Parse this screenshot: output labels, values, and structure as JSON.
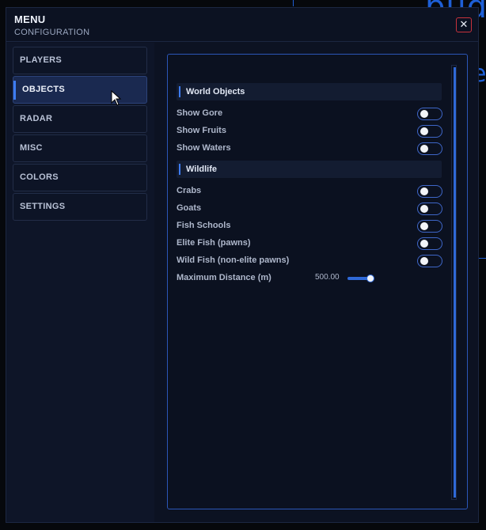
{
  "window": {
    "title": "MENU",
    "subtitle": "CONFIGURATION",
    "close_label": "✕"
  },
  "background_text": {
    "large": "bud",
    "small": "e"
  },
  "sidebar": {
    "items": [
      {
        "label": "PLAYERS",
        "active": false
      },
      {
        "label": "OBJECTS",
        "active": true
      },
      {
        "label": "RADAR",
        "active": false
      },
      {
        "label": "MISC",
        "active": false
      },
      {
        "label": "COLORS",
        "active": false
      },
      {
        "label": "SETTINGS",
        "active": false
      }
    ]
  },
  "panel": {
    "sections": [
      {
        "title": "World Objects",
        "rows": [
          {
            "label": "Show Gore",
            "on": false
          },
          {
            "label": "Show Fruits",
            "on": false
          },
          {
            "label": "Show Waters",
            "on": false
          }
        ]
      },
      {
        "title": "Wildlife",
        "rows": [
          {
            "label": "Crabs",
            "on": false
          },
          {
            "label": "Goats",
            "on": false
          },
          {
            "label": "Fish Schools",
            "on": false
          },
          {
            "label": "Elite Fish (pawns)",
            "on": false
          },
          {
            "label": "Wild Fish (non-elite pawns)",
            "on": false
          }
        ]
      }
    ],
    "slider": {
      "label": "Maximum Distance (m)",
      "value": "500.00",
      "fraction": 1.0
    }
  },
  "colors": {
    "accent": "#3d7cf2",
    "panel_border": "#2b56b8",
    "close_border": "#c7323c",
    "background": "#06080c"
  }
}
